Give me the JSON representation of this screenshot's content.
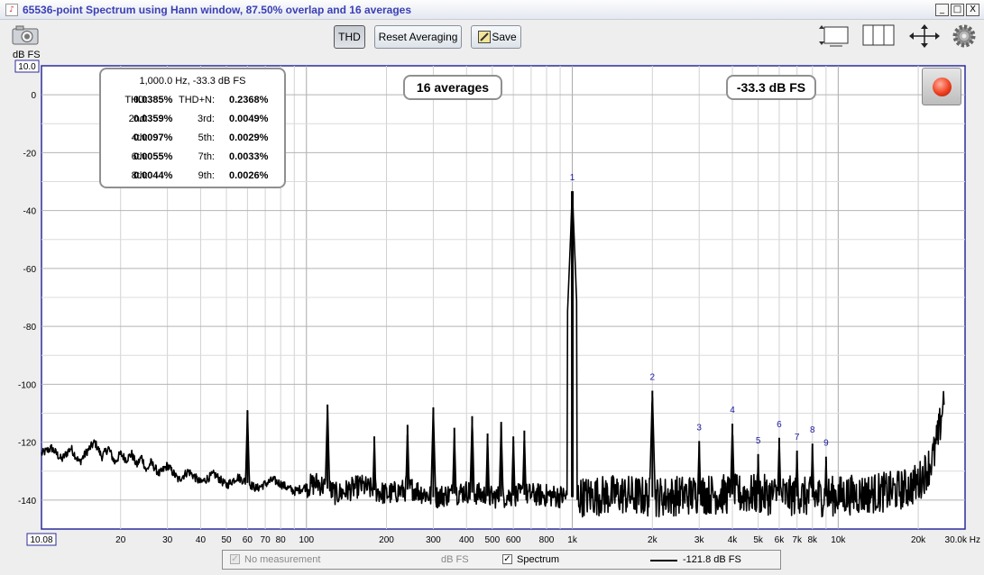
{
  "window": {
    "title": "65536-point Spectrum using Hann window, 87.50% overlap and 16 averages",
    "controls": [
      "_",
      "□",
      "X"
    ]
  },
  "toolbar": {
    "thd_label": "THD",
    "reset_label": "Reset Averaging",
    "save_label": "Save"
  },
  "thd_panel": {
    "header": "1,000.0 Hz, -33.3 dB FS",
    "rows": [
      {
        "k1": "THD:",
        "v1": "0.0385%",
        "k2": "THD+N:",
        "v2": "0.2368%"
      },
      {
        "k1": "2nd:",
        "v1": "0.0359%",
        "k2": "3rd:",
        "v2": "0.0049%"
      },
      {
        "k1": "4th:",
        "v1": "0.0097%",
        "k2": "5th:",
        "v2": "0.0029%"
      },
      {
        "k1": "6th:",
        "v1": "0.0055%",
        "k2": "7th:",
        "v2": "0.0033%"
      },
      {
        "k1": "8th:",
        "v1": "0.0044%",
        "k2": "9th:",
        "v2": "0.0026%"
      }
    ]
  },
  "badges": {
    "averages": "16 averages",
    "level": "-33.3 dB FS"
  },
  "legend": {
    "no_measurement": "No measurement",
    "no_measurement_unit": "dB FS",
    "spectrum_label": "Spectrum",
    "spectrum_value": "-121.8 dB FS"
  },
  "chart_data": {
    "type": "line",
    "ylabel": "dB FS",
    "y_axis_top_value": "10.0",
    "x_axis_left_value": "10.08",
    "x_scale": "log",
    "xlim": [
      10.08,
      30000
    ],
    "ylim": [
      -150,
      10
    ],
    "x_ticks": [
      {
        "v": 20,
        "label": "20"
      },
      {
        "v": 30,
        "label": "30"
      },
      {
        "v": 40,
        "label": "40"
      },
      {
        "v": 50,
        "label": "50"
      },
      {
        "v": 60,
        "label": "60"
      },
      {
        "v": 70,
        "label": "70"
      },
      {
        "v": 80,
        "label": "80"
      },
      {
        "v": 100,
        "label": "100"
      },
      {
        "v": 200,
        "label": "200"
      },
      {
        "v": 300,
        "label": "300"
      },
      {
        "v": 400,
        "label": "400"
      },
      {
        "v": 500,
        "label": "500"
      },
      {
        "v": 600,
        "label": "600"
      },
      {
        "v": 800,
        "label": "800"
      },
      {
        "v": 1000,
        "label": "1k"
      },
      {
        "v": 2000,
        "label": "2k"
      },
      {
        "v": 3000,
        "label": "3k"
      },
      {
        "v": 4000,
        "label": "4k"
      },
      {
        "v": 5000,
        "label": "5k"
      },
      {
        "v": 6000,
        "label": "6k"
      },
      {
        "v": 7000,
        "label": "7k"
      },
      {
        "v": 8000,
        "label": "8k"
      },
      {
        "v": 10000,
        "label": "10k"
      },
      {
        "v": 20000,
        "label": "20k"
      },
      {
        "v": 30000,
        "label": "30.0k Hz"
      }
    ],
    "y_ticks": [
      0,
      -20,
      -40,
      -60,
      -80,
      -100,
      -120,
      -140
    ],
    "grid": true,
    "series": [
      {
        "name": "Spectrum",
        "color": "#000000",
        "noise_floor": [
          [
            10.08,
            -124
          ],
          [
            11,
            -122
          ],
          [
            12,
            -126
          ],
          [
            13,
            -122
          ],
          [
            14,
            -127
          ],
          [
            15,
            -123
          ],
          [
            16,
            -120
          ],
          [
            17,
            -125
          ],
          [
            18,
            -122
          ],
          [
            19,
            -127
          ],
          [
            20,
            -124
          ],
          [
            21,
            -126
          ],
          [
            22,
            -124
          ],
          [
            23,
            -128
          ],
          [
            24,
            -125
          ],
          [
            25,
            -130
          ],
          [
            26,
            -127
          ],
          [
            28,
            -131
          ],
          [
            30,
            -128
          ],
          [
            33,
            -133
          ],
          [
            36,
            -130
          ],
          [
            40,
            -134
          ],
          [
            45,
            -131
          ],
          [
            50,
            -135
          ],
          [
            55,
            -132
          ],
          [
            65,
            -136
          ],
          [
            75,
            -133
          ],
          [
            90,
            -137
          ],
          [
            110,
            -134
          ],
          [
            130,
            -138
          ],
          [
            160,
            -135
          ],
          [
            200,
            -138
          ],
          [
            250,
            -136
          ],
          [
            300,
            -139
          ],
          [
            400,
            -137
          ],
          [
            500,
            -139
          ],
          [
            700,
            -138
          ],
          [
            1000,
            -139
          ],
          [
            1500,
            -138
          ],
          [
            2000,
            -139
          ],
          [
            3000,
            -138
          ],
          [
            5000,
            -138
          ],
          [
            8000,
            -139
          ],
          [
            12000,
            -138
          ],
          [
            16000,
            -137
          ],
          [
            18000,
            -136
          ],
          [
            20000,
            -134
          ],
          [
            21000,
            -131
          ],
          [
            22000,
            -128
          ],
          [
            23000,
            -124
          ],
          [
            24000,
            -116
          ],
          [
            24500,
            -110
          ],
          [
            25000,
            -104
          ]
        ],
        "peaks": [
          {
            "f": 60,
            "db": -109
          },
          {
            "f": 120,
            "db": -107
          },
          {
            "f": 180,
            "db": -118
          },
          {
            "f": 240,
            "db": -114
          },
          {
            "f": 300,
            "db": -108
          },
          {
            "f": 360,
            "db": -115
          },
          {
            "f": 420,
            "db": -111
          },
          {
            "f": 480,
            "db": -117
          },
          {
            "f": 540,
            "db": -113
          },
          {
            "f": 600,
            "db": -118
          },
          {
            "f": 660,
            "db": -116
          },
          {
            "f": 1000,
            "db": -33.3
          },
          {
            "f": 2000,
            "db": -102.2
          },
          {
            "f": 3000,
            "db": -119.6
          },
          {
            "f": 4000,
            "db": -113.6
          },
          {
            "f": 5000,
            "db": -124.1
          },
          {
            "f": 6000,
            "db": -118.5
          },
          {
            "f": 7000,
            "db": -122.9
          },
          {
            "f": 8000,
            "db": -120.5
          },
          {
            "f": 9000,
            "db": -125.0
          }
        ]
      }
    ],
    "harmonic_markers": [
      {
        "label": "1",
        "f": 1000,
        "db": -33.3
      },
      {
        "label": "2",
        "f": 2000,
        "db": -102.2
      },
      {
        "label": "3",
        "f": 3000,
        "db": -119.6
      },
      {
        "label": "4",
        "f": 4000,
        "db": -113.6
      },
      {
        "label": "5",
        "f": 5000,
        "db": -124.1
      },
      {
        "label": "6",
        "f": 6000,
        "db": -118.5
      },
      {
        "label": "7",
        "f": 7000,
        "db": -122.9
      },
      {
        "label": "8",
        "f": 8000,
        "db": -120.5
      },
      {
        "label": "9",
        "f": 9000,
        "db": -125.0
      }
    ]
  }
}
